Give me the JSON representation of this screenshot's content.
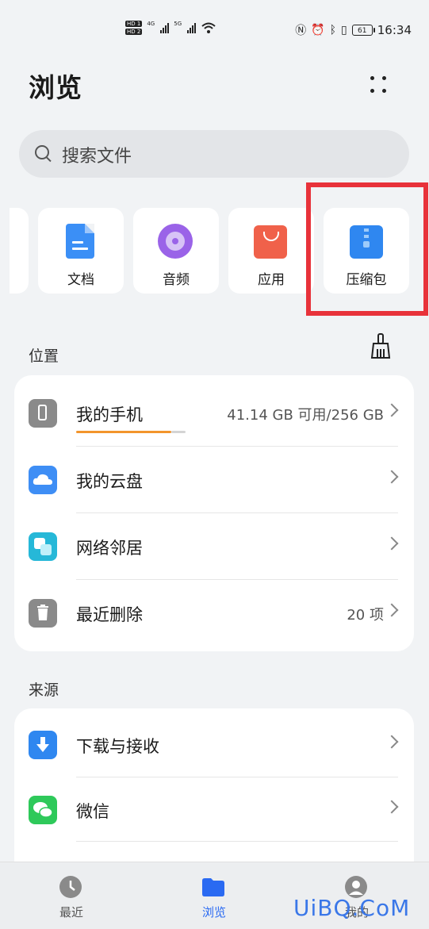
{
  "status_bar": {
    "hd1": "HD 1",
    "hd2": "HD 2",
    "net1": "4G",
    "net2": "5G",
    "battery": "61",
    "time": "16:34"
  },
  "header": {
    "title": "浏览"
  },
  "search": {
    "placeholder": "搜索文件"
  },
  "categories": [
    {
      "label": "文档",
      "icon": "document-icon",
      "color": "#3b8ff6"
    },
    {
      "label": "音频",
      "icon": "audio-icon",
      "color": "#9a63e8"
    },
    {
      "label": "应用",
      "icon": "app-bag-icon",
      "color": "#f0614a"
    },
    {
      "label": "压缩包",
      "icon": "zip-icon",
      "color": "#2f87f0"
    }
  ],
  "location": {
    "section_label": "位置",
    "items": [
      {
        "name": "我的手机",
        "value": "41.14 GB 可用/256 GB",
        "icon": "phone-icon",
        "storage_used_fraction": 0.84
      },
      {
        "name": "我的云盘",
        "value": "",
        "icon": "cloud-icon"
      },
      {
        "name": "网络邻居",
        "value": "",
        "icon": "network-icon"
      },
      {
        "name": "最近删除",
        "value": "20 项",
        "icon": "trash-icon"
      }
    ]
  },
  "source": {
    "section_label": "来源",
    "items": [
      {
        "name": "下载与接收",
        "icon": "download-icon"
      },
      {
        "name": "微信",
        "icon": "wechat-icon"
      }
    ]
  },
  "bottom_nav": [
    {
      "label": "最近",
      "icon": "clock-icon"
    },
    {
      "label": "浏览",
      "icon": "folder-icon",
      "active": true
    },
    {
      "label": "我的",
      "icon": "profile-icon"
    }
  ],
  "watermark": "UiBQ.CoM",
  "highlight_color": "#e8323a"
}
